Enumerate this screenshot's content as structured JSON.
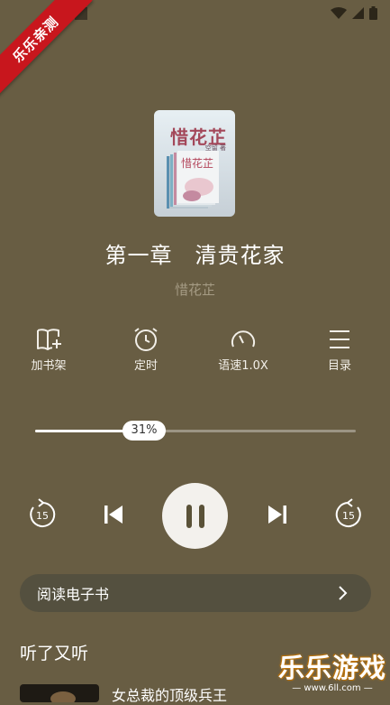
{
  "ribbon": {
    "text": "乐乐亲测"
  },
  "book": {
    "cover_title": "惜花芷",
    "cover_author": "空留 著",
    "chapter_title": "第一章　清贵花家",
    "book_name": "惜花芷"
  },
  "actions": [
    {
      "label": "加书架",
      "icon": "add-bookshelf-icon"
    },
    {
      "label": "定时",
      "icon": "alarm-clock-icon"
    },
    {
      "label": "语速1.0X",
      "icon": "speed-gauge-icon"
    },
    {
      "label": "目录",
      "icon": "menu-list-icon"
    }
  ],
  "progress": {
    "label": "31%",
    "value": 0.31
  },
  "ebook_button": {
    "label": "阅读电子书"
  },
  "section_title": "听了又听",
  "recommend": {
    "title": "女总裁的顶级兵王"
  },
  "watermark": {
    "brand": "乐乐游戏",
    "url": "— www.6ll.com —"
  }
}
